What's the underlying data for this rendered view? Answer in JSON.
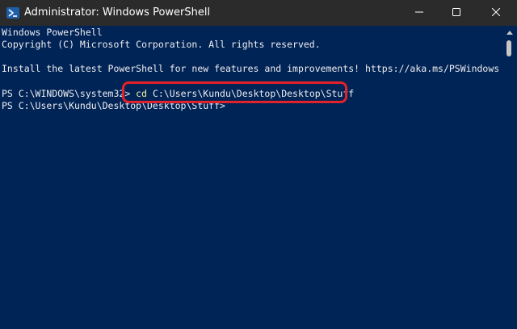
{
  "window": {
    "title": "Administrator: Windows PowerShell"
  },
  "console": {
    "lines": [
      "Windows PowerShell",
      "Copyright (C) Microsoft Corporation. All rights reserved.",
      "",
      "Install the latest PowerShell for new features and improvements! https://aka.ms/PSWindows",
      ""
    ],
    "prompt1": "PS C:\\WINDOWS\\system32> ",
    "command_keyword": "cd",
    "command_arg": " C:\\Users\\Kundu\\Desktop\\Desktop\\Stuff",
    "prompt2": "PS C:\\Users\\Kundu\\Desktop\\Desktop\\Stuff>"
  },
  "icons": {
    "app": "powershell-icon",
    "minimize": "minimize-icon",
    "maximize": "maximize-icon",
    "close": "close-icon"
  },
  "colors": {
    "console_background": "#012456",
    "titlebar_background": "#2b2b2b",
    "highlight_ring": "#e2212b",
    "command_keyword": "#f9f1a5"
  }
}
